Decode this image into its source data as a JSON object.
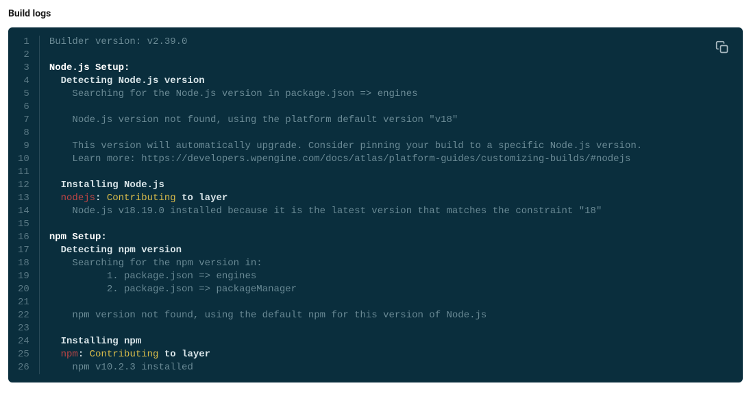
{
  "title": "Build logs",
  "lines": [
    {
      "num": 1,
      "segments": [
        {
          "cls": "muted",
          "text": "Builder version: v2.39.0"
        }
      ]
    },
    {
      "num": 2,
      "segments": []
    },
    {
      "num": 3,
      "segments": [
        {
          "cls": "bold-white",
          "text": "Node.js Setup:"
        }
      ]
    },
    {
      "num": 4,
      "segments": [
        {
          "cls": "white",
          "text": "  Detecting Node.js version"
        }
      ]
    },
    {
      "num": 5,
      "segments": [
        {
          "cls": "muted",
          "text": "    Searching for the Node.js version in package.json => engines"
        }
      ]
    },
    {
      "num": 6,
      "segments": []
    },
    {
      "num": 7,
      "segments": [
        {
          "cls": "muted",
          "text": "    Node.js version not found, using the platform default version \"v18\""
        }
      ]
    },
    {
      "num": 8,
      "segments": []
    },
    {
      "num": 9,
      "segments": [
        {
          "cls": "muted",
          "text": "    This version will automatically upgrade. Consider pinning your build to a specific Node.js version."
        }
      ]
    },
    {
      "num": 10,
      "segments": [
        {
          "cls": "muted",
          "text": "    Learn more: https://developers.wpengine.com/docs/atlas/platform-guides/customizing-builds/#nodejs"
        }
      ]
    },
    {
      "num": 11,
      "segments": []
    },
    {
      "num": 12,
      "segments": [
        {
          "cls": "white",
          "text": "  Installing Node.js"
        }
      ]
    },
    {
      "num": 13,
      "segments": [
        {
          "cls": "red",
          "text": "  nodejs"
        },
        {
          "cls": "white",
          "text": ": "
        },
        {
          "cls": "yellow",
          "text": "Contributing"
        },
        {
          "cls": "white",
          "text": " to layer"
        }
      ]
    },
    {
      "num": 14,
      "segments": [
        {
          "cls": "muted",
          "text": "    Node.js v18.19.0 installed because it is the latest version that matches the constraint \"18\""
        }
      ]
    },
    {
      "num": 15,
      "segments": []
    },
    {
      "num": 16,
      "segments": [
        {
          "cls": "bold-white",
          "text": "npm Setup:"
        }
      ]
    },
    {
      "num": 17,
      "segments": [
        {
          "cls": "white",
          "text": "  Detecting npm version"
        }
      ]
    },
    {
      "num": 18,
      "segments": [
        {
          "cls": "muted",
          "text": "    Searching for the npm version in:"
        }
      ]
    },
    {
      "num": 19,
      "segments": [
        {
          "cls": "muted",
          "text": "          1. package.json => engines"
        }
      ]
    },
    {
      "num": 20,
      "segments": [
        {
          "cls": "muted",
          "text": "          2. package.json => packageManager"
        }
      ]
    },
    {
      "num": 21,
      "segments": []
    },
    {
      "num": 22,
      "segments": [
        {
          "cls": "muted",
          "text": "    npm version not found, using the default npm for this version of Node.js"
        }
      ]
    },
    {
      "num": 23,
      "segments": []
    },
    {
      "num": 24,
      "segments": [
        {
          "cls": "white",
          "text": "  Installing npm"
        }
      ]
    },
    {
      "num": 25,
      "segments": [
        {
          "cls": "red",
          "text": "  npm"
        },
        {
          "cls": "white",
          "text": ": "
        },
        {
          "cls": "yellow",
          "text": "Contributing"
        },
        {
          "cls": "white",
          "text": " to layer"
        }
      ]
    },
    {
      "num": 26,
      "segments": [
        {
          "cls": "muted",
          "text": "    npm v10.2.3 installed"
        }
      ]
    }
  ]
}
